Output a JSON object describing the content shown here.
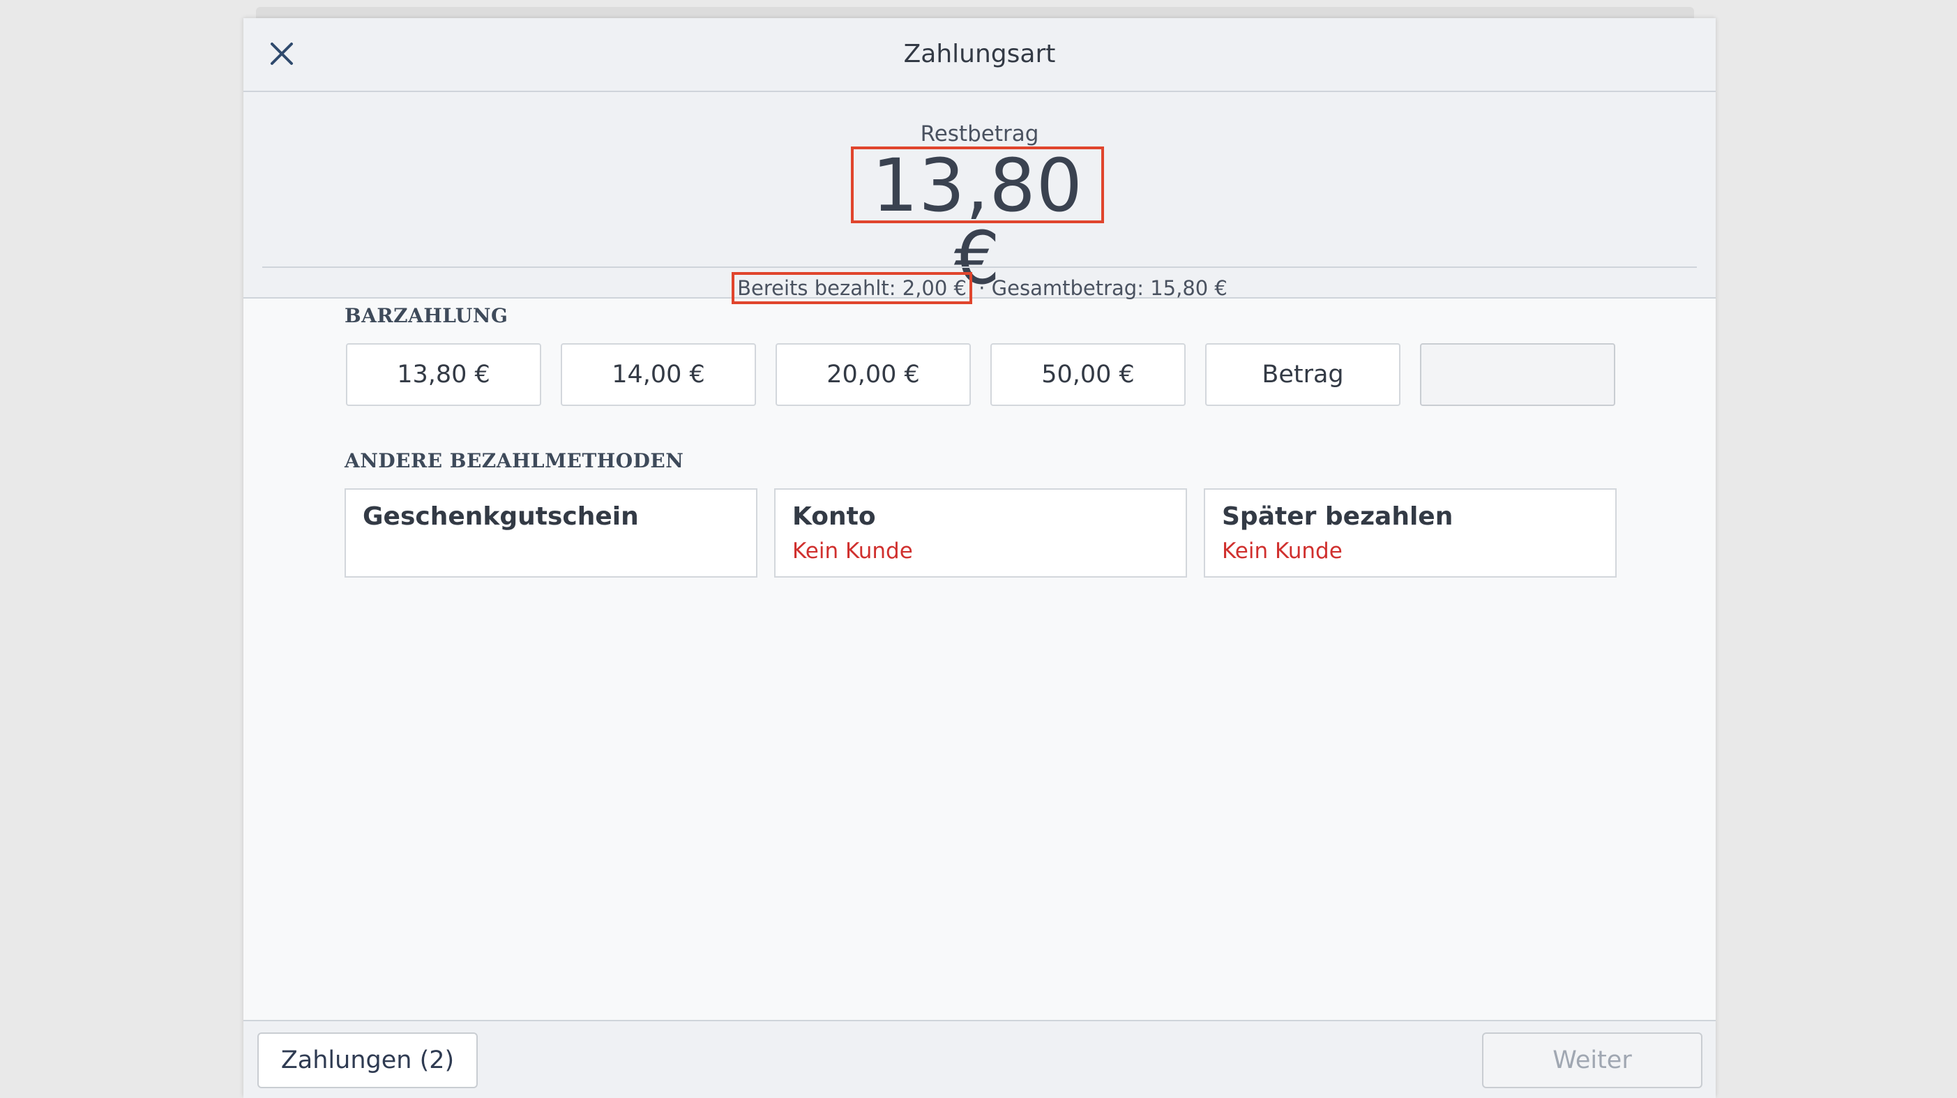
{
  "header": {
    "title": "Zahlungsart",
    "close_icon": "close-icon"
  },
  "summary": {
    "rest_label": "Restbetrag",
    "rest_amount": "13,80 €",
    "paid_text": "Bereits bezahlt: 2,00 €",
    "separator": " · ",
    "total_text": "Gesamtbetrag: 15,80 €"
  },
  "cash": {
    "section_label": "BARZAHLUNG",
    "buttons": [
      {
        "label": "13,80 €"
      },
      {
        "label": "14,00 €"
      },
      {
        "label": "20,00 €"
      },
      {
        "label": "50,00 €"
      },
      {
        "label": "Betrag"
      },
      {
        "label": ""
      }
    ]
  },
  "methods": {
    "section_label": "ANDERE BEZAHLMETHODEN",
    "items": [
      {
        "title": "Geschenkgutschein",
        "subtitle": ""
      },
      {
        "title": "Konto",
        "subtitle": "Kein Kunde"
      },
      {
        "title": "Später bezahlen",
        "subtitle": "Kein Kunde"
      }
    ]
  },
  "footer": {
    "payments_label": "Zahlungen (2)",
    "next_label": "Weiter"
  },
  "colors": {
    "highlight": "#e0452d",
    "warning_text": "#d0302e",
    "accent": "#2f4a6d"
  }
}
